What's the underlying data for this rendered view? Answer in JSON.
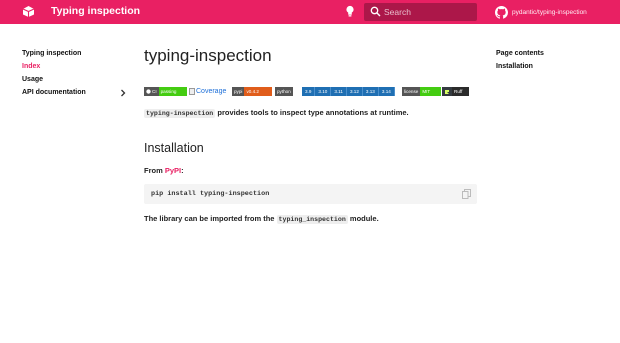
{
  "header": {
    "site_title": "Typing inspection",
    "search_placeholder": "Search",
    "repo_name": "pydantic/typing-inspection",
    "brand_color": "#e92063",
    "icons": {
      "logo": "pydantic-logo-icon",
      "theme": "lightbulb-icon",
      "search": "search-icon",
      "repo": "github-icon"
    }
  },
  "nav": {
    "title": "Typing inspection",
    "items": [
      {
        "label": "Index",
        "active": true
      },
      {
        "label": "Usage",
        "active": false
      },
      {
        "label": "API documentation",
        "active": false,
        "expandable": true
      }
    ]
  },
  "main": {
    "title": "typing-inspection",
    "badges": {
      "ci": {
        "label": "CI",
        "value": "passing"
      },
      "coverage": {
        "alt": "Coverage"
      },
      "pypi": {
        "label": "pypi",
        "value": "v0.4.2"
      },
      "python": {
        "label": "python",
        "versions": [
          "3.9",
          "3.10",
          "3.11",
          "3.12",
          "3.13",
          "3.14"
        ]
      },
      "license": {
        "label": "license",
        "value": "MIT"
      },
      "ruff": {
        "label": "Ruff"
      }
    },
    "intro_code": "typing-inspection",
    "intro_text": " provides tools to inspect type annotations at runtime.",
    "install_heading": "Installation",
    "from_prefix": "From ",
    "from_link": "PyPI",
    "from_suffix": ":",
    "install_command": "pip install typing-inspection",
    "outro_prefix": "The library can be imported from the ",
    "outro_code": "typing_inspection",
    "outro_suffix": " module."
  },
  "toc": {
    "title": "Page contents",
    "items": [
      "Installation"
    ]
  }
}
